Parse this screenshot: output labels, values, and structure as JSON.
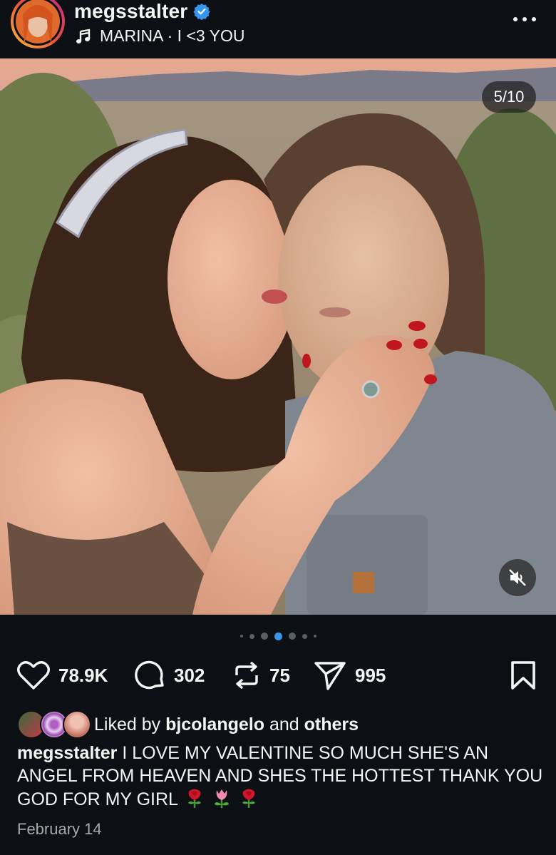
{
  "post": {
    "username": "megsstalter",
    "audio": "MARINA · I <3 YOU",
    "counter": "5/10",
    "slide_total": 10,
    "slide_current": 5,
    "stats": {
      "likes": "78.9K",
      "comments": "302",
      "reposts": "75",
      "shares": "995"
    },
    "liked_by_prefix": "Liked by",
    "liked_by_user": "bjcolangelo",
    "liked_by_and": "and",
    "liked_by_others": "others",
    "caption_user": "megsstalter",
    "caption_text": "I LOVE MY VALENTINE SO MUCH SHE'S AN ANGEL FROM HEAVEN AND SHES THE HOTTEST THANK YOU GOD FOR MY GIRL",
    "caption_emoji": [
      "rose",
      "tulip",
      "rose"
    ],
    "date": "February 14"
  },
  "icons": {
    "verified": "verified-badge-icon",
    "music": "music-note-icon",
    "more": "more-options-icon",
    "like": "heart-icon",
    "comment": "comment-icon",
    "repost": "repost-icon",
    "share": "share-icon",
    "save": "bookmark-icon",
    "mute": "speaker-muted-icon"
  },
  "colors": {
    "background": "#0c1014",
    "text": "#f5f5f5",
    "secondary_text": "#a8a8a8",
    "verified_blue": "#3797f0",
    "active_dot": "#3797f0"
  }
}
